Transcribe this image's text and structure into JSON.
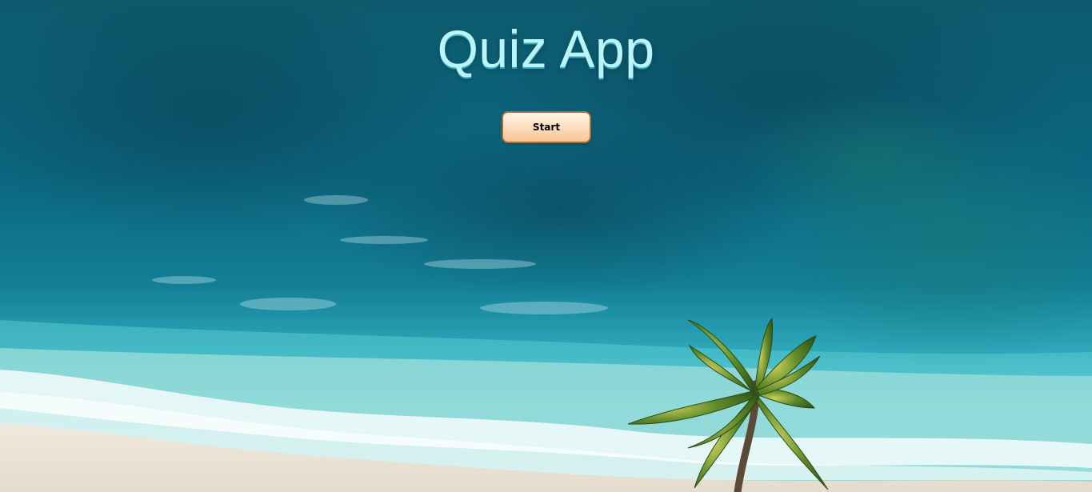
{
  "page": {
    "title": "Quiz App",
    "background": "tropical-beach-aerial-photo"
  },
  "actions": {
    "start_label": "Start"
  },
  "colors": {
    "title": "#b9f5fb",
    "button_top": "#fff6e8",
    "button_bottom": "#f8c493",
    "button_border": "#a86f3c",
    "deep_water": "#0b4f63",
    "shallow_water": "#3cc2cf",
    "sand": "#e9e2d6"
  }
}
